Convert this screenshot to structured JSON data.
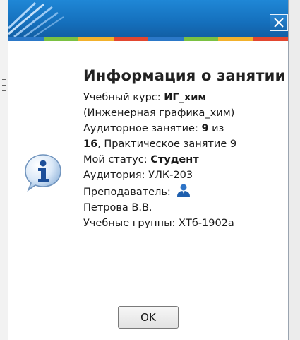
{
  "dialog": {
    "title": "Информация о занятии",
    "course": {
      "label": "Учебный курс: ",
      "value": "ИГ_хим",
      "full_name": "(Инженерная графика_хим)"
    },
    "lesson": {
      "label": "Аудиторное занятие: ",
      "number": "9",
      "of": " из",
      "total": "16",
      "rest": ", Практическое занятие 9"
    },
    "status": {
      "label": "Мой статус: ",
      "value": "Студент"
    },
    "room": "Аудитория: УЛК-203",
    "teacher": {
      "label": "Преподаватель:",
      "name": "Петрова В.В."
    },
    "groups": "Учебные группы: ХТб-1902а",
    "ok_label": "OK"
  },
  "icons": {
    "close": "close-icon",
    "info": "info-icon",
    "person": "person-icon"
  },
  "colors": {
    "titlebar": "#1570bd",
    "stripe": [
      "#2b78c8",
      "#7ac142",
      "#f2b12c",
      "#e2462f",
      "#2b78c8",
      "#7ac142",
      "#f2b12c",
      "#e2462f"
    ]
  }
}
